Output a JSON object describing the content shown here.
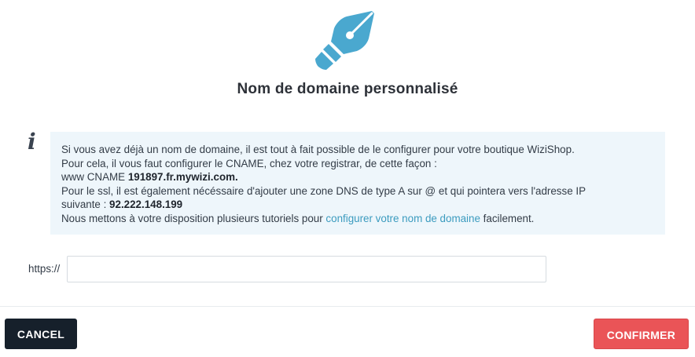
{
  "header": {
    "icon": "fountain-pen-nib-icon",
    "icon_color": "#4aa8cf",
    "title": "Nom de domaine personnalisé"
  },
  "info": {
    "icon": "info-icon",
    "line1": "Si vous avez déjà un nom de domaine, il est tout à fait possible de le configurer pour votre boutique WiziShop.",
    "line2": "Pour cela, il vous faut configurer le CNAME, chez votre registrar, de cette façon :",
    "line3_prefix": "www CNAME ",
    "cname_target": "191897.fr.mywizi.com.",
    "line4": "Pour le ssl, il est également nécéssaire d'ajouter une zone DNS de type A sur @ et qui pointera vers l'adresse IP",
    "line5_prefix": "suivante : ",
    "ip_address": "92.222.148.199",
    "line6_prefix": "Nous mettons à votre disposition plusieurs tutoriels pour ",
    "tutorial_link": "configurer votre nom de domaine",
    "line6_suffix": " facilement."
  },
  "form": {
    "url_prefix": "https://",
    "domain_value": "",
    "domain_placeholder": ""
  },
  "footer": {
    "cancel_label": "CANCEL",
    "confirm_label": "CONFIRMER",
    "cancel_color": "#16202b",
    "confirm_color": "#ea5457"
  }
}
